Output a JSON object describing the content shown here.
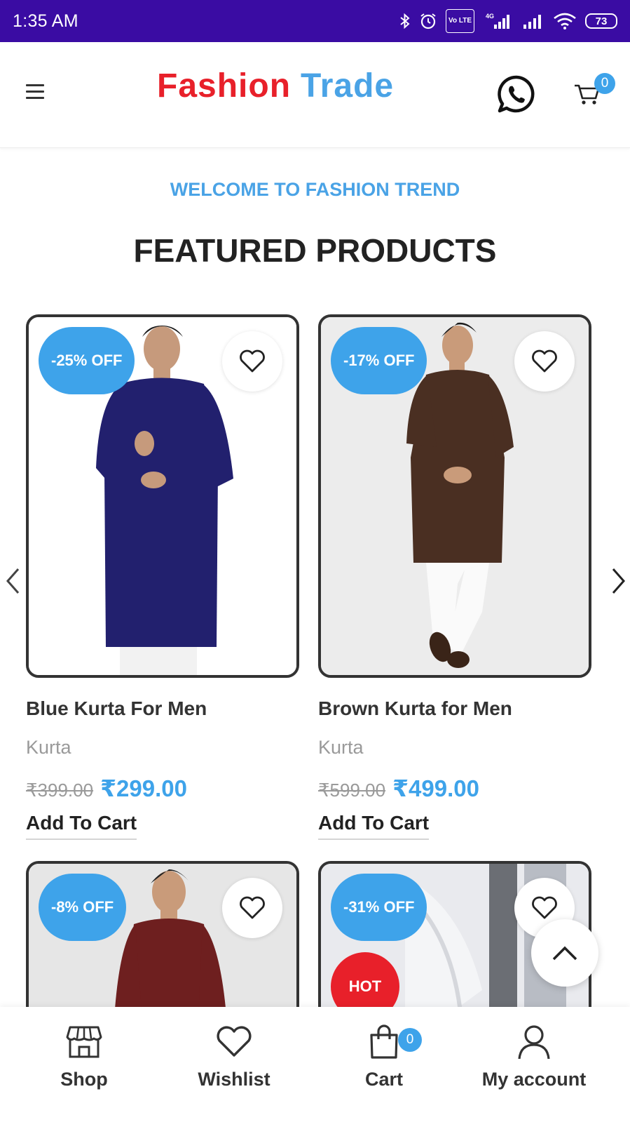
{
  "status_bar": {
    "time": "1:35 AM",
    "network": "4G",
    "volte": "Vo LTE",
    "battery": "73"
  },
  "header": {
    "logo_part1": "Fashion",
    "logo_part2": "Trade",
    "cart_count": "0",
    "colors": {
      "logo_red": "#e8202a",
      "logo_blue": "#4aa3e6",
      "status_bar": "#3a0ca3"
    }
  },
  "welcome_text": "WELCOME TO FASHION TREND",
  "featured_title": "FEATURED PRODUCTS",
  "carousel": {
    "prev_icon": "chevron-left-icon",
    "next_icon": "chevron-right-icon"
  },
  "products": [
    {
      "discount": "-25% OFF",
      "name": "Blue Kurta For Men",
      "category": "Kurta",
      "old_price": "₹399.00",
      "price": "₹299.00",
      "add_to_cart": "Add To Cart",
      "kurta_color": "#22206e"
    },
    {
      "discount": "-17% OFF",
      "name": "Brown Kurta for Men",
      "category": "Kurta",
      "old_price": "₹599.00",
      "price": "₹499.00",
      "add_to_cart": "Add To Cart",
      "kurta_color": "#4a2f22"
    },
    {
      "discount": "-8% OFF",
      "kurta_color": "#6e1f1f"
    },
    {
      "discount": "-31% OFF",
      "hot_label": "HOT"
    }
  ],
  "bottom_nav": {
    "shop": "Shop",
    "wishlist": "Wishlist",
    "cart": "Cart",
    "cart_count": "0",
    "account": "My account"
  },
  "accent_color": "#3ea3ea"
}
